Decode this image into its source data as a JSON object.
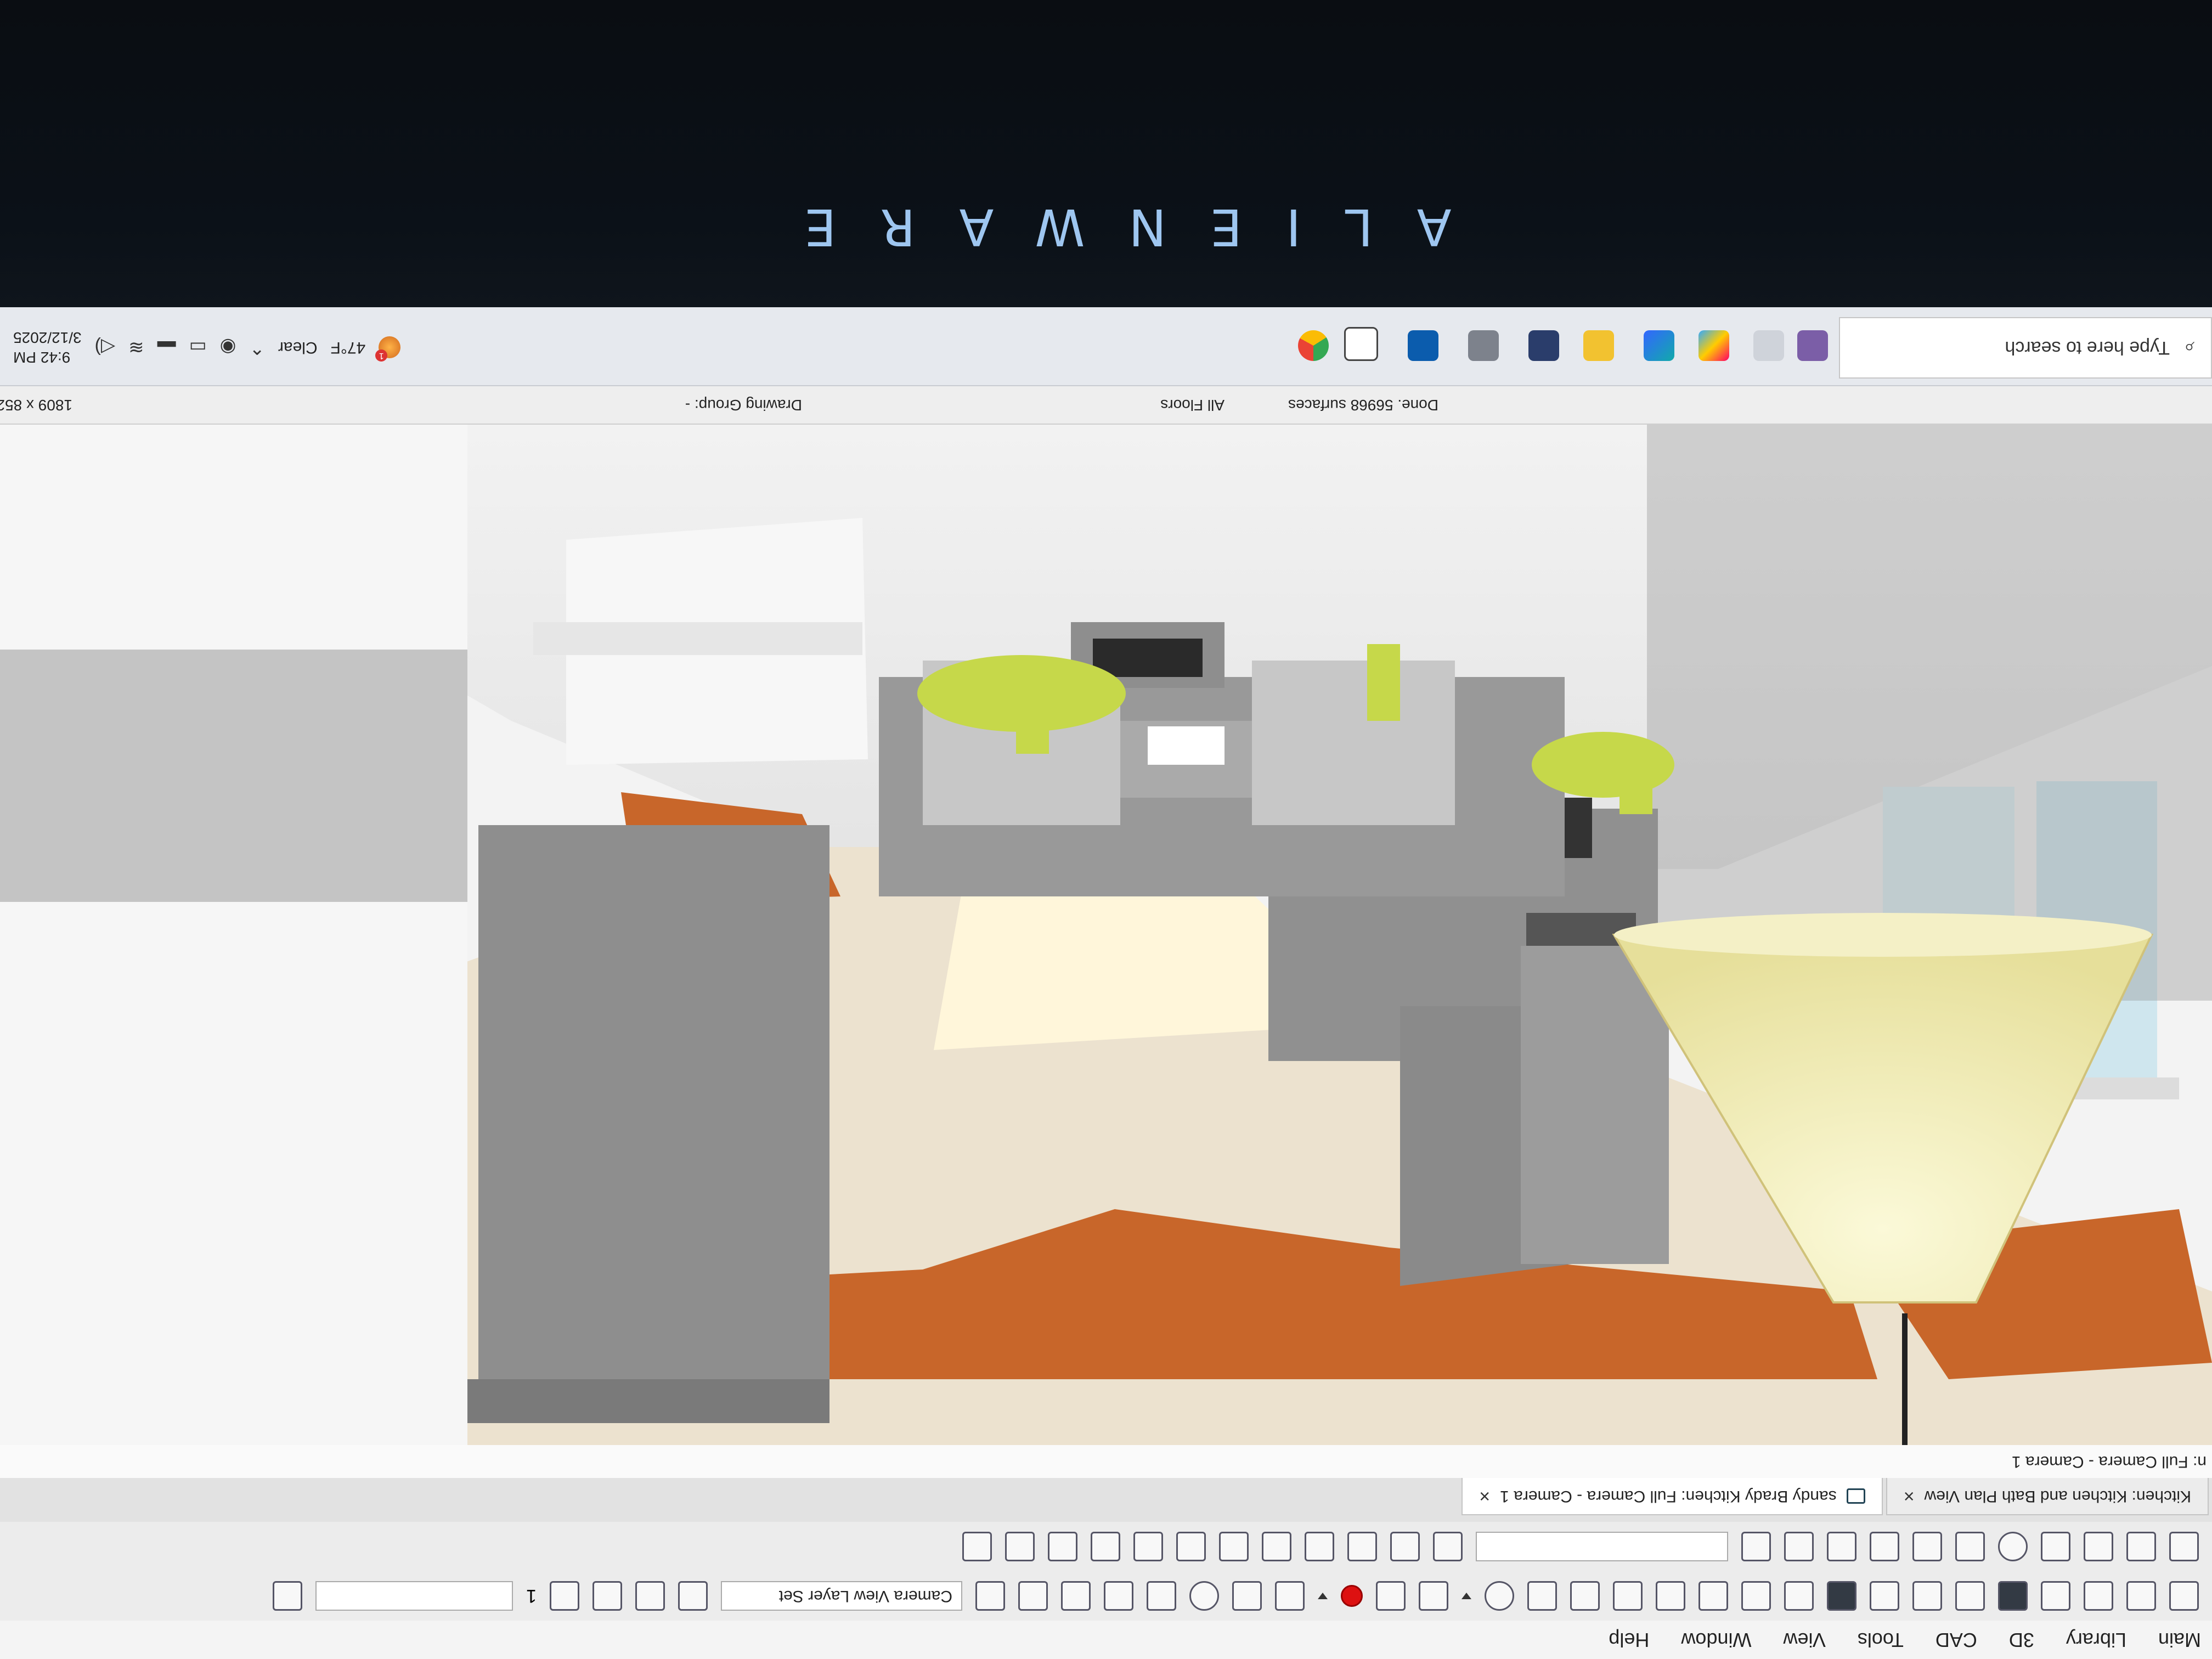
{
  "bezel": {
    "brand": "ALIENWARE"
  },
  "menu": {
    "items": [
      "Main",
      "Library",
      "3D",
      "CAD",
      "Tools",
      "View",
      "Window",
      "Help"
    ]
  },
  "toolbar": {
    "layer_set": "Camera View Layer Set",
    "floor_number": "1"
  },
  "tabs": [
    {
      "label": "Kitchen: Kitchen and Bath Plan View",
      "active": false
    },
    {
      "label": "sandy Brady Kitchen: Full Camera - Camera 1",
      "active": true
    }
  ],
  "view_caption": "n: Full Camera - Camera 1",
  "status": {
    "dimensions": "1809 x 852",
    "drawing_group": "Drawing Group: -",
    "floors": "All Floors",
    "progress": "Done.  56968 surfaces"
  },
  "taskbar": {
    "search_placeholder": "Type here to search",
    "weather_temp": "47°F",
    "weather_condition": "Clear",
    "weather_alert": "1",
    "time": "9:42 PM",
    "date": "3/12/2025",
    "pinned_icons": [
      "app-icon",
      "task-view-icon",
      "copilot-icon",
      "edge-icon",
      "file-explorer-icon",
      "store-icon",
      "settings-icon",
      "outlook-icon",
      "snipping-tool-icon",
      "chrome-icon"
    ]
  },
  "colors": {
    "ceiling": "#c8662a",
    "wall": "#f0f0f0",
    "cabinet_gray": "#8e8e8e",
    "pendant_glass": "#f3f0bf",
    "glass_green": "#c6d84a"
  }
}
